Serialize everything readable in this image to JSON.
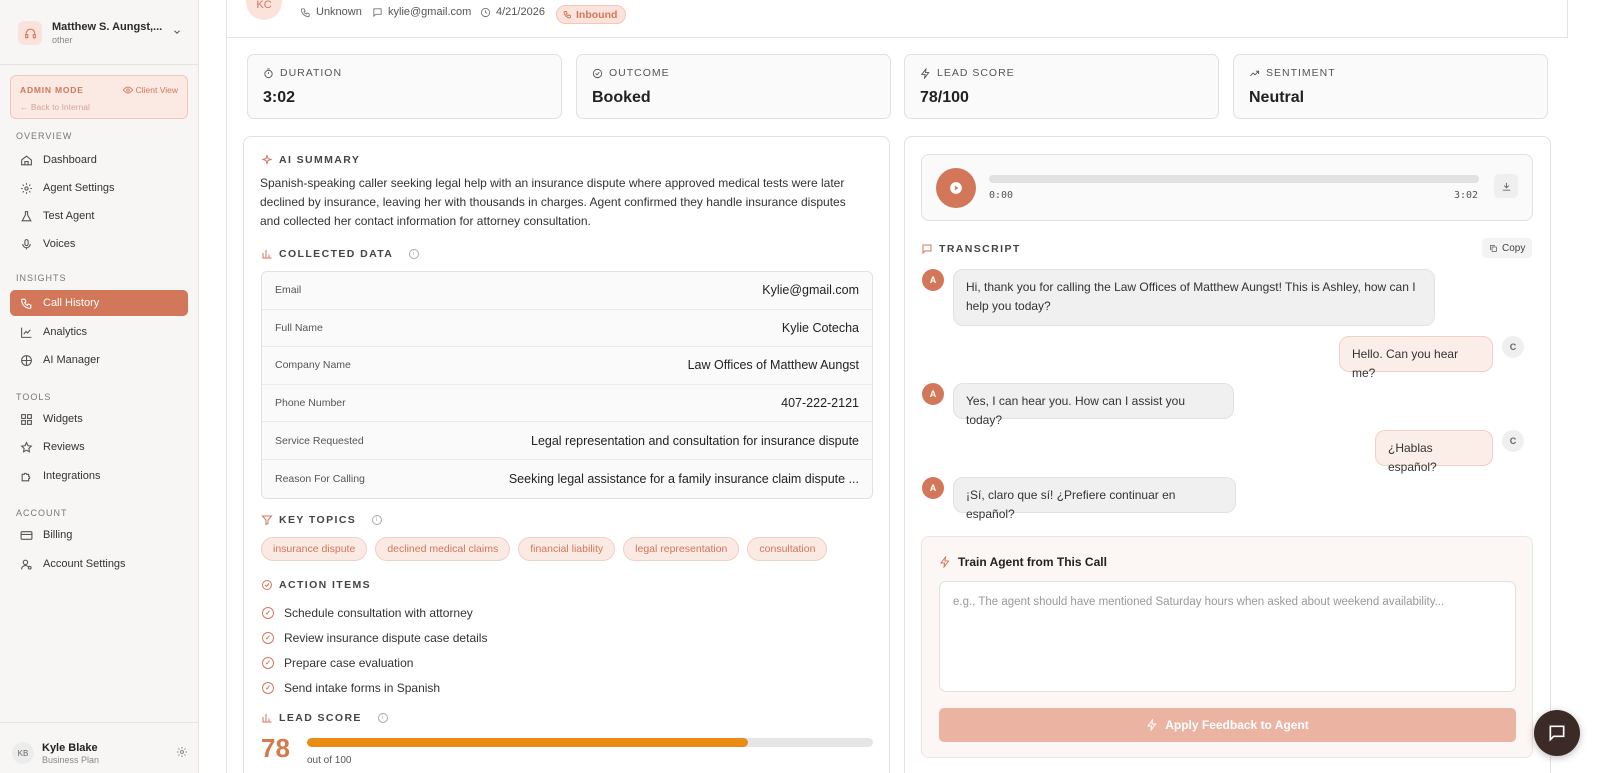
{
  "sidebar": {
    "account": {
      "name": "Matthew S. Aungst,...",
      "type": "other"
    },
    "admin": {
      "label": "ADMIN MODE",
      "client_view": "Client View",
      "back": "← Back to Internal"
    },
    "sections": {
      "overview": "OVERVIEW",
      "insights": "INSIGHTS",
      "tools": "TOOLS",
      "account": "ACCOUNT"
    },
    "items": [
      {
        "label": "Dashboard",
        "icon": "home-icon"
      },
      {
        "label": "Agent Settings",
        "icon": "gear-icon"
      },
      {
        "label": "Test Agent",
        "icon": "flask-icon"
      },
      {
        "label": "Voices",
        "icon": "microphone-icon"
      },
      {
        "label": "Call History",
        "icon": "phone-icon",
        "active": true
      },
      {
        "label": "Analytics",
        "icon": "chart-icon"
      },
      {
        "label": "AI Manager",
        "icon": "brain-icon"
      },
      {
        "label": "Widgets",
        "icon": "grid-icon"
      },
      {
        "label": "Reviews",
        "icon": "star-icon"
      },
      {
        "label": "Integrations",
        "icon": "puzzle-icon"
      },
      {
        "label": "Billing",
        "icon": "card-icon"
      },
      {
        "label": "Account Settings",
        "icon": "user-gear-icon"
      }
    ],
    "user": {
      "initials": "KB",
      "name": "Kyle Blake",
      "plan": "Business Plan"
    }
  },
  "header": {
    "initials": "KC",
    "phone": "Unknown",
    "email": "kylie@gmail.com",
    "date": "4/21/2026",
    "direction": "Inbound"
  },
  "stats": [
    {
      "label": "DURATION",
      "value": "3:02",
      "icon": "timer-icon"
    },
    {
      "label": "OUTCOME",
      "value": "Booked",
      "icon": "check-circle-icon"
    },
    {
      "label": "LEAD SCORE",
      "value": "78/100",
      "icon": "bolt-icon"
    },
    {
      "label": "SENTIMENT",
      "value": "Neutral",
      "icon": "trend-icon"
    }
  ],
  "summary": {
    "title": "AI SUMMARY",
    "text": "Spanish-speaking caller seeking legal help with an insurance dispute where approved medical tests were later declined by insurance, leaving her with thousands in charges. Agent confirmed they handle insurance disputes and collected her contact information for attorney consultation."
  },
  "collected": {
    "title": "COLLECTED DATA",
    "rows": [
      {
        "key": "Email",
        "value": "Kylie@gmail.com"
      },
      {
        "key": "Full Name",
        "value": "Kylie Cotecha"
      },
      {
        "key": "Company Name",
        "value": "Law Offices of Matthew Aungst"
      },
      {
        "key": "Phone Number",
        "value": "407-222-2121"
      },
      {
        "key": "Service Requested",
        "value": "Legal representation and consultation for insurance dispute"
      },
      {
        "key": "Reason For Calling",
        "value": "Seeking legal assistance for a family insurance claim dispute ..."
      }
    ]
  },
  "topics": {
    "title": "KEY TOPICS",
    "items": [
      "insurance dispute",
      "declined medical claims",
      "financial liability",
      "legal representation",
      "consultation"
    ]
  },
  "actions": {
    "title": "ACTION ITEMS",
    "items": [
      "Schedule consultation with attorney",
      "Review insurance dispute case details",
      "Prepare case evaluation",
      "Send intake forms in Spanish"
    ]
  },
  "lead": {
    "title": "LEAD SCORE",
    "score": "78",
    "out_of": "out of 100",
    "fraction": 0.78
  },
  "audio": {
    "current": "0:00",
    "total": "3:02",
    "progress": 0
  },
  "transcript": {
    "title": "TRANSCRIPT",
    "copy": "Copy",
    "messages": [
      {
        "speaker": "A",
        "text": "Hi, thank you for calling the Law Offices of Matthew Aungst! This is Ashley, how can I help you today?"
      },
      {
        "speaker": "C",
        "text": "Hello. Can you hear me?"
      },
      {
        "speaker": "A",
        "text": "Yes, I can hear you. How can I assist you today?"
      },
      {
        "speaker": "C",
        "text": "¿Hablas español?"
      },
      {
        "speaker": "A",
        "text": "¡Sí, claro que sí! ¿Prefiere continuar en español?"
      }
    ]
  },
  "train": {
    "title": "Train Agent from This Call",
    "placeholder": "e.g., The agent should have mentioned Saturday hours when asked about weekend availability...",
    "button": "Apply Feedback to Agent"
  },
  "colors": {
    "accent": "#d27759",
    "score_bar": "#ea8c14",
    "fab": "#3b2a26"
  }
}
